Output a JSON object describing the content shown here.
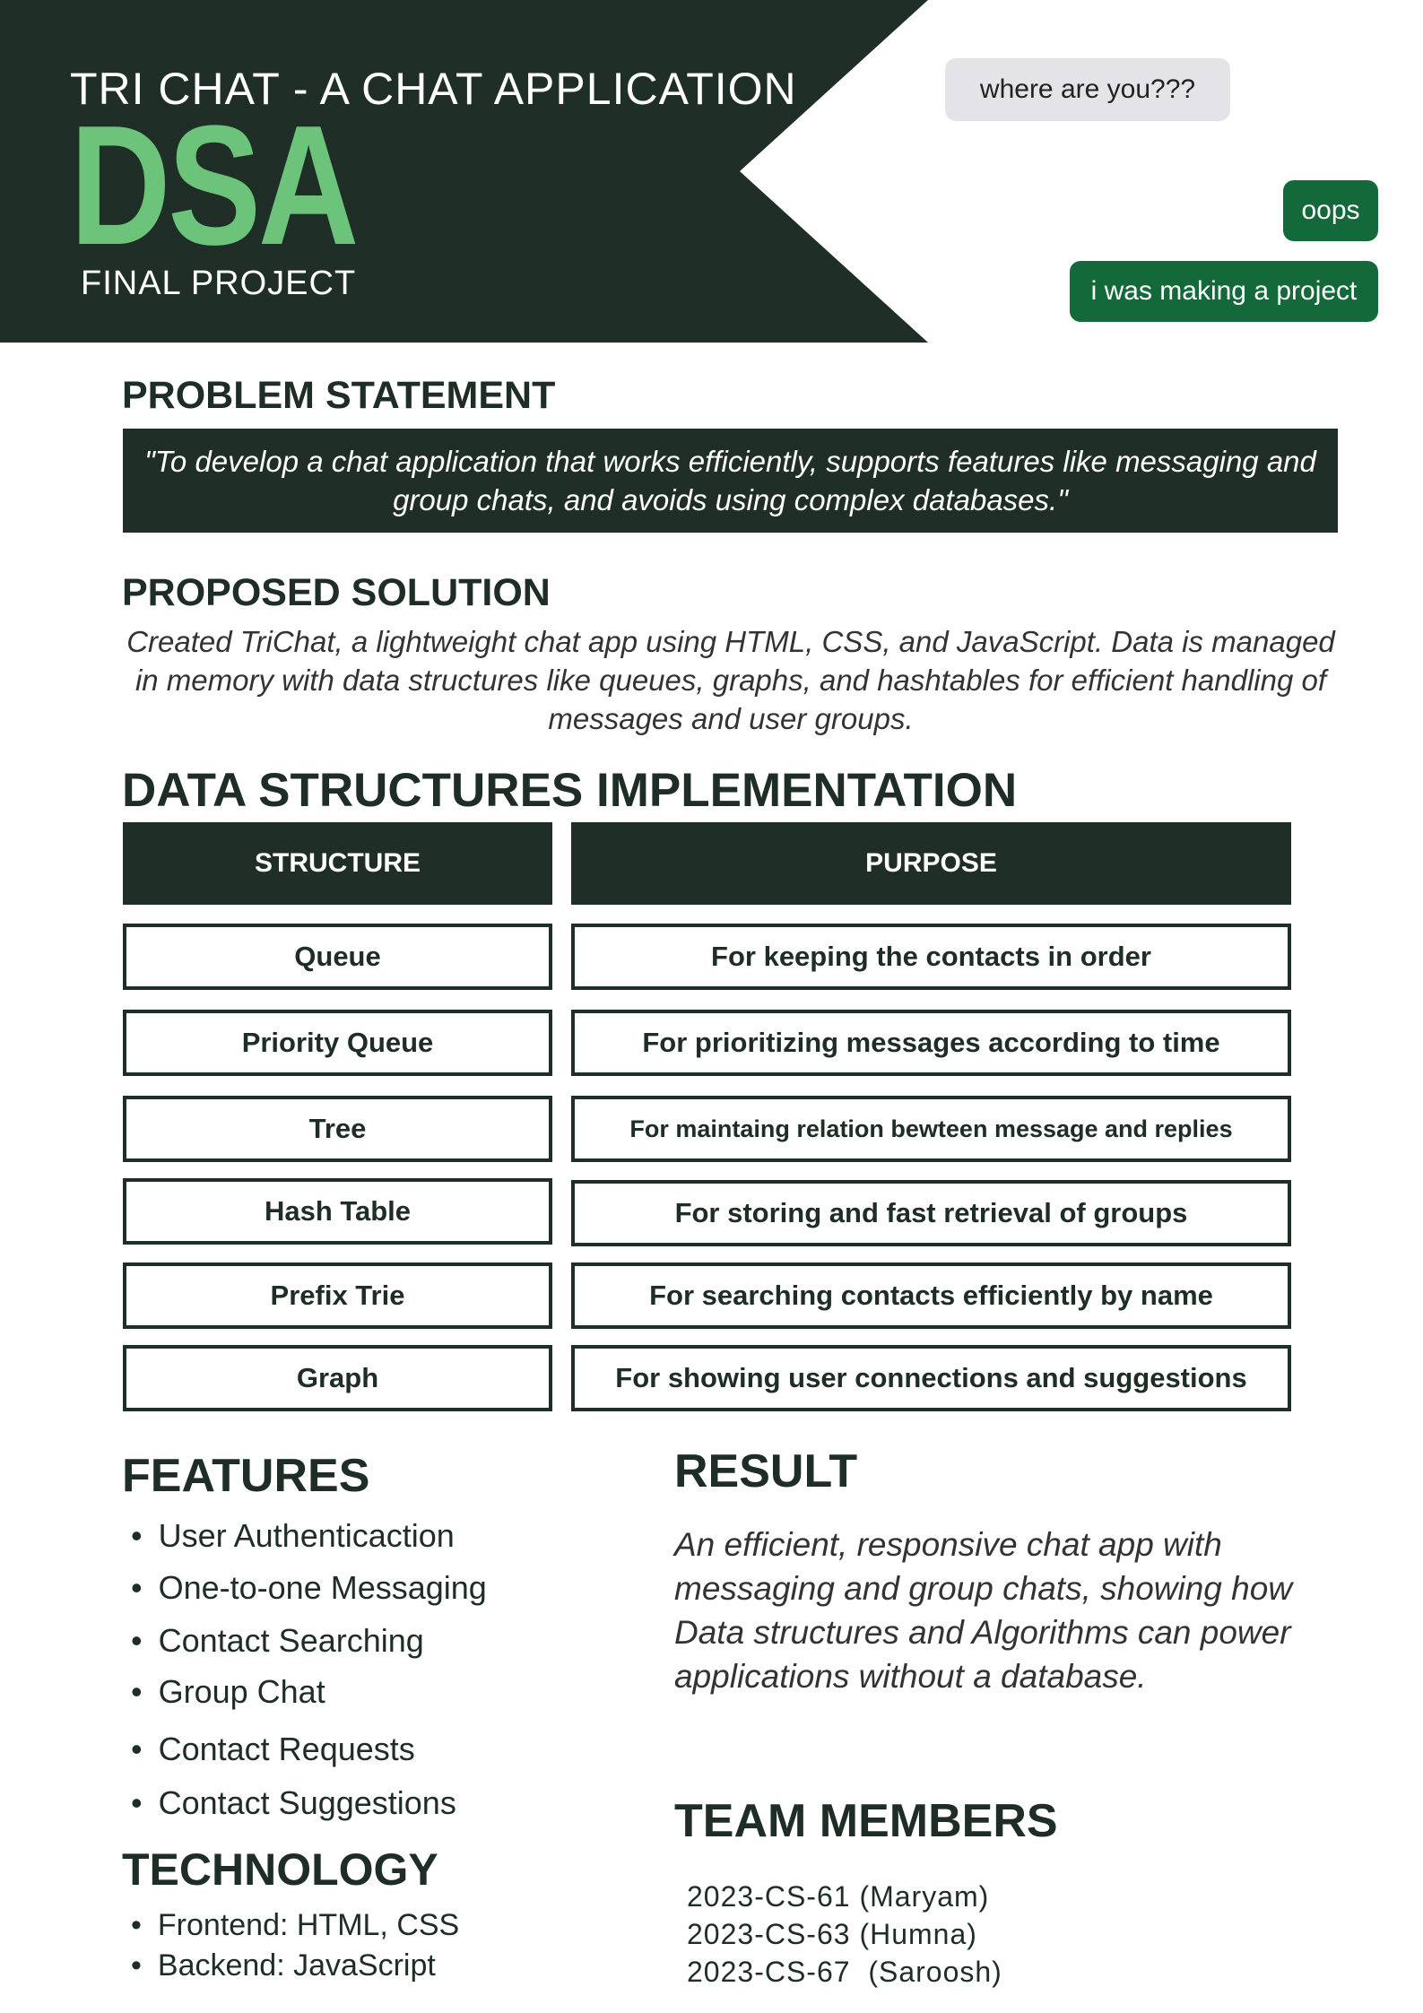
{
  "header": {
    "title": "TRI CHAT - A CHAT APPLICATION",
    "dsa": "DSA",
    "subtitle": "FINAL PROJECT"
  },
  "chat": {
    "bubble_1": "where are you???",
    "bubble_2": "oops",
    "bubble_3": "i was making a project"
  },
  "problem": {
    "heading": "PROBLEM STATEMENT",
    "text": "\"To develop a chat application that works efficiently, supports features like messaging and group chats, and avoids using complex databases.\""
  },
  "proposed": {
    "heading": "PROPOSED SOLUTION",
    "text": "Created TriChat, a lightweight chat app using HTML, CSS, and JavaScript. Data is managed in memory with data structures like queues, graphs, and hashtables for efficient handling of messages and user groups."
  },
  "ds": {
    "heading": "DATA STRUCTURES IMPLEMENTATION",
    "col_structure": "STRUCTURE",
    "col_purpose": "PURPOSE",
    "rows": [
      {
        "structure": "Queue",
        "purpose": "For keeping the contacts in order"
      },
      {
        "structure": "Priority Queue",
        "purpose": "For prioritizing messages according to time"
      },
      {
        "structure": "Tree",
        "purpose": "For maintaing relation bewteen message and replies"
      },
      {
        "structure": "Hash Table",
        "purpose": "For storing and fast retrieval of groups"
      },
      {
        "structure": "Prefix Trie",
        "purpose": "For searching contacts efficiently by name"
      },
      {
        "structure": "Graph",
        "purpose": "For showing user connections and suggestions"
      }
    ]
  },
  "features": {
    "heading": "FEATURES",
    "items": [
      "User Authenticaction",
      "One-to-one Messaging",
      "Contact Searching",
      "Group Chat",
      "Contact Requests",
      "Contact Suggestions"
    ]
  },
  "technology": {
    "heading": "TECHNOLOGY",
    "items": [
      "Frontend: HTML, CSS",
      "Backend: JavaScript"
    ]
  },
  "result": {
    "heading": "RESULT",
    "text": "An efficient, responsive chat app with messaging and group chats, showing how Data structures and Algorithms can power applications without a database."
  },
  "team": {
    "heading": "TEAM MEMBERS",
    "members": [
      "2023-CS-61 (Maryam)",
      "2023-CS-63 (Humna)",
      "2023-CS-67  (Saroosh)"
    ]
  },
  "colors": {
    "dark": "#1f2f28",
    "accent_green": "#6cc37a",
    "bubble_green": "#14693a",
    "bubble_gray": "#e4e4e8"
  }
}
